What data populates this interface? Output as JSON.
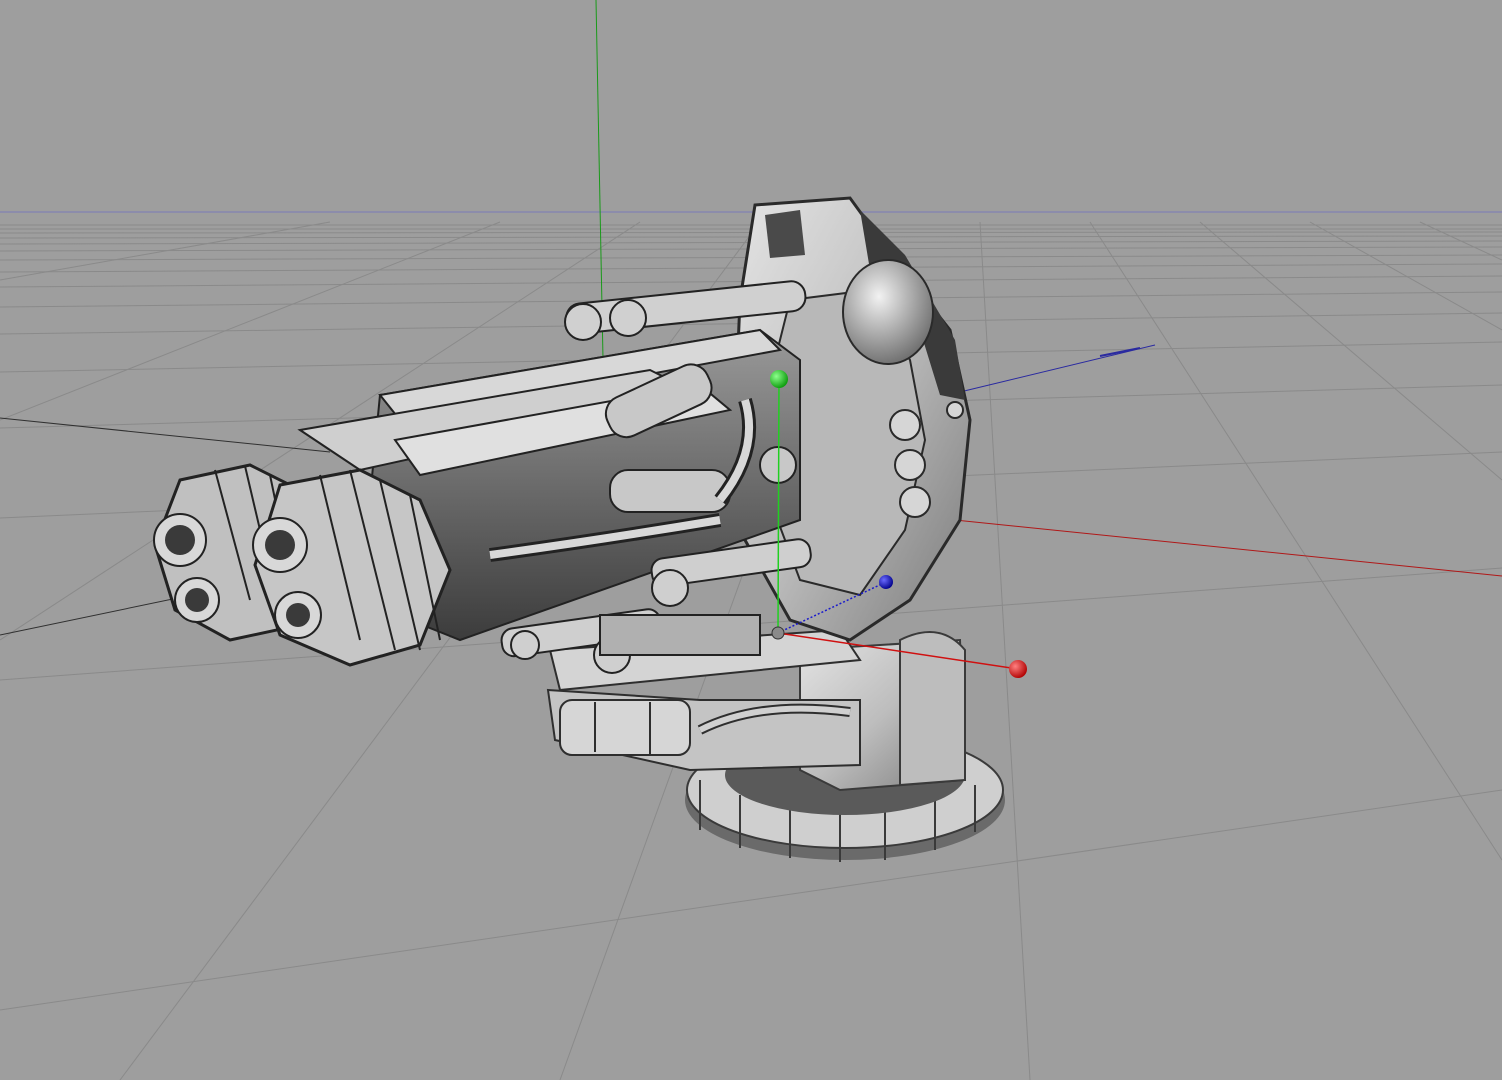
{
  "viewport": {
    "background": "#9e9e9e",
    "grid_color": "#8a8a8a",
    "horizon_color": "#6f6fb0",
    "model": "turret",
    "model_color": "#c8c8c8",
    "model_shadow": "#4a4a4a"
  },
  "axes": {
    "x_color": "#cc1111",
    "y_color": "#10c010",
    "z_color": "#1a1acc",
    "world_x_color": "#b01818",
    "world_y_color": "#1a9a1a",
    "world_z_color": "#2a2aa0"
  },
  "gizmo_handles": [
    "x-handle",
    "y-handle",
    "z-handle",
    "pivot"
  ]
}
